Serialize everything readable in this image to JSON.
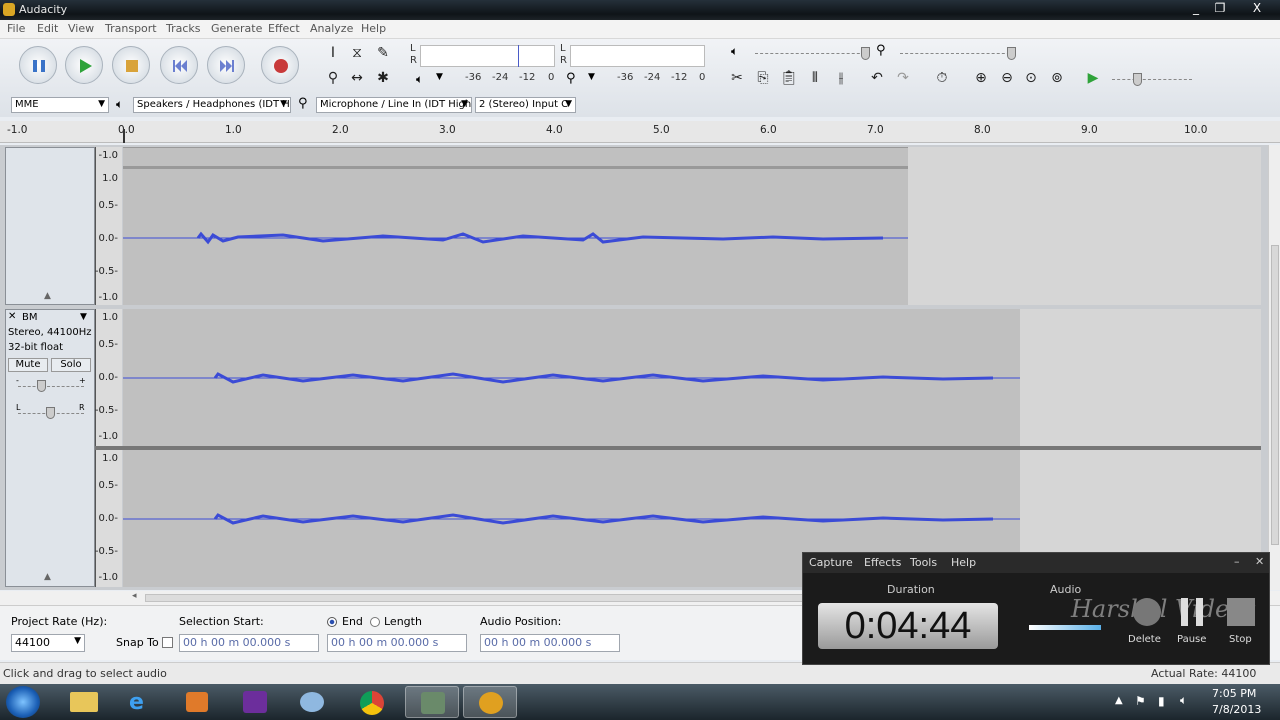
{
  "app": {
    "title": "Audacity"
  },
  "window_controls": [
    "_",
    "❐",
    "X"
  ],
  "menu": [
    "File",
    "Edit",
    "View",
    "Transport",
    "Tracks",
    "Generate",
    "Effect",
    "Analyze",
    "Help"
  ],
  "meters": {
    "playback_scale": [
      "-36",
      "-24",
      "-12",
      "0"
    ],
    "record_scale": [
      "-36",
      "-24",
      "-12",
      "0"
    ],
    "l": "L",
    "r": "R"
  },
  "device": {
    "host": "MME",
    "output": "Speakers / Headphones (IDT H",
    "input": "Microphone / Line In (IDT High",
    "channels": "2 (Stereo) Input C"
  },
  "ruler": [
    "-1.0",
    "0.0",
    "1.0",
    "2.0",
    "3.0",
    "4.0",
    "5.0",
    "6.0",
    "7.0",
    "8.0",
    "9.0",
    "10.0"
  ],
  "track1": {
    "scale_top": [
      "-1.0"
    ],
    "scale": [
      "1.0",
      "0.5-",
      "0.0-",
      "-0.5-",
      "-1.0"
    ]
  },
  "track2": {
    "name": "BM",
    "info1": "Stereo, 44100Hz",
    "info2": "32-bit float",
    "mute": "Mute",
    "solo": "Solo",
    "gain_minus": "-",
    "gain_plus": "+",
    "pan_l": "L",
    "pan_r": "R",
    "scale": [
      "1.0",
      "0.5-",
      "0.0-",
      "-0.5-",
      "-1.0"
    ],
    "scale2": [
      "1.0",
      "0.5-",
      "0.0-",
      "-0.5-",
      "-1.0"
    ]
  },
  "selection_bar": {
    "project_rate_label": "Project Rate (Hz):",
    "project_rate": "44100",
    "snap_to": "Snap To",
    "selection_start_label": "Selection Start:",
    "end_label": "End",
    "length_label": "Length",
    "audio_position_label": "Audio Position:",
    "time_value": "00 h 00 m 00.000 s"
  },
  "status": {
    "left": "Click and drag to select audio",
    "right": "Actual Rate: 44100"
  },
  "recorder": {
    "menu": [
      "Capture",
      "Effects",
      "Tools",
      "Help"
    ],
    "duration_label": "Duration",
    "duration": "0:04:44",
    "audio_label": "Audio",
    "watermark": "Harshal Videos",
    "delete": "Delete",
    "pause": "Pause",
    "stop": "Stop"
  },
  "tray": {
    "time": "7:05 PM",
    "date": "7/8/2013"
  }
}
